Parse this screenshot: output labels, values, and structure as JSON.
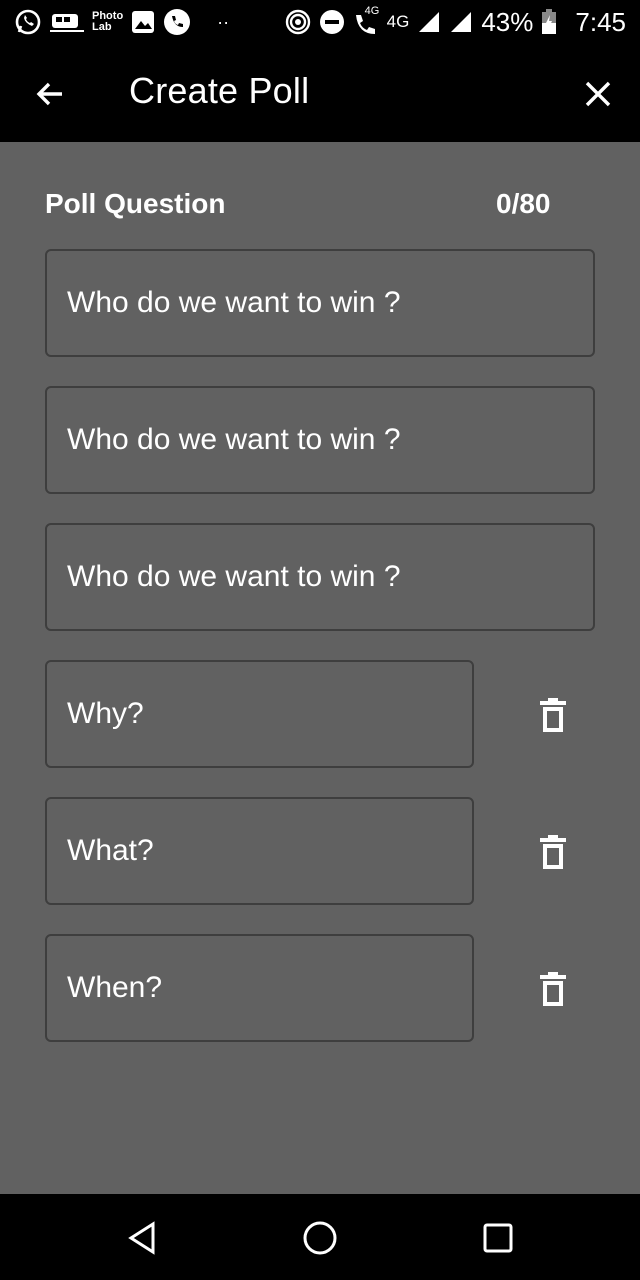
{
  "status_bar": {
    "photo_lab_line1": "Photo",
    "photo_lab_line2": "Lab",
    "dots": "··",
    "call_4g": "4G",
    "network": "4G",
    "battery": "43%",
    "time": "7:45"
  },
  "app_bar": {
    "title": "Create Poll"
  },
  "poll": {
    "question_label": "Poll Question",
    "counter": "0/80",
    "fields": [
      {
        "value": "Who do we want to win ?"
      },
      {
        "value": "Who do we want to win ?"
      },
      {
        "value": "Who do we want to win ?"
      },
      {
        "value": "Why?"
      },
      {
        "value": "What?"
      },
      {
        "value": "When?"
      }
    ]
  },
  "colors": {
    "background": "#616161",
    "bars": "#000000",
    "text": "#ffffff",
    "field_border": "#3e3e3e"
  }
}
